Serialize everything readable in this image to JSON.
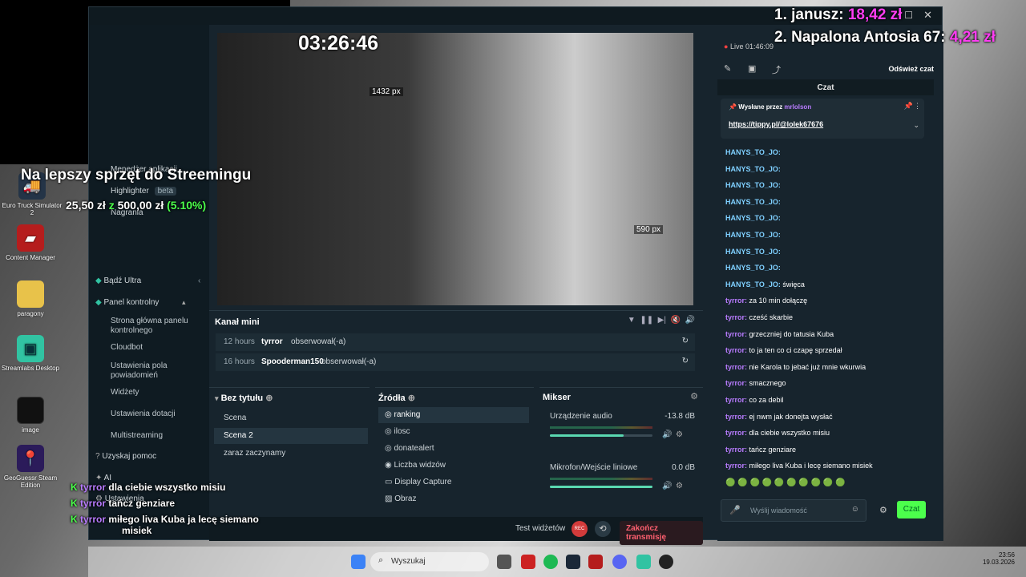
{
  "overlay": {
    "clock": "03:26:46",
    "top1": "1. janusz:",
    "top1_amount": "18,42 zł",
    "top2": "2. Napalona Antosia 67:",
    "top2_amount": "4,21 zł",
    "goal_title": "Na lepszy sprzęt do Streemingu",
    "goal_current": "25,50 zł",
    "goal_sep": "z",
    "goal_target": "500,00 zł",
    "goal_pct": "(5.10%)",
    "goal_pct_value": 5.1,
    "side_chat": [
      {
        "user": "tyrror",
        "text": "dla ciebie wszystko misiu"
      },
      {
        "user": "tyrror",
        "text": "tańcz genziare"
      },
      {
        "user": "tyrror",
        "text": "miłego liva Kuba ja lecę siemano"
      },
      {
        "user": "",
        "text": "misiek"
      }
    ]
  },
  "desktop": {
    "icons": [
      {
        "label": "Euro Truck Simulator 2",
        "icon": "truck-icon"
      },
      {
        "label": "Content Manager",
        "icon": "content-manager-icon"
      },
      {
        "label": "paragony",
        "icon": "folder-icon"
      },
      {
        "label": "Streamlabs Desktop",
        "icon": "streamlabs-icon"
      },
      {
        "label": "image",
        "icon": "image-icon"
      },
      {
        "label": "GeoGuessr Steam Edition",
        "icon": "geoguessr-icon"
      }
    ]
  },
  "sidebar": {
    "menedzer": "Menedżer aplikacji",
    "highlighter": "Highlighter",
    "beta": "beta",
    "nagrania": "Nagrania",
    "ultra": "Bądź Ultra",
    "panel": "Panel kontrolny",
    "sub": [
      "Strona główna panelu kontrolnego",
      "Cloudbot",
      "Ustawienia pola powiadomień",
      "Widżety",
      "Ustawienia dotacji",
      "Multistreaming"
    ],
    "help": "Uzyskaj pomoc",
    "ai": "AI",
    "settings": "Ustawienia"
  },
  "preview": {
    "width_label": "1432 px",
    "height_label": "590 px"
  },
  "mini_feed": {
    "title": "Kanał mini",
    "rows": [
      {
        "time": "12 hours",
        "user": "tyrror",
        "action": "obserwował(-a)"
      },
      {
        "time": "16 hours",
        "user": "Spooderman150",
        "action": "obserwował(-a)"
      }
    ]
  },
  "scenes": {
    "title": "Bez tytułu",
    "items": [
      "Scena",
      "Scena 2",
      "zaraz zaczynamy"
    ],
    "selected": "Scena 2"
  },
  "sources": {
    "title": "Źródła",
    "items": [
      "ranking",
      "ilosc",
      "donatealert",
      "Liczba widzów",
      "Display Capture",
      "Obraz"
    ],
    "selected": "ranking"
  },
  "mixer": {
    "title": "Mikser",
    "channels": [
      {
        "name": "Urządzenie audio",
        "db": "-13.8 dB",
        "level": 0.72
      },
      {
        "name": "Mikrofon/Wejście liniowe",
        "db": "0.0 dB",
        "level": 1.0
      }
    ]
  },
  "footer": {
    "test": "Test widżetów",
    "rec": "REC",
    "end": "Zakończ transmisję"
  },
  "chat": {
    "live": "Live 01:46:09",
    "refresh": "Odśwież czat",
    "title": "Czat",
    "pinned_by_label": "Wysłane przez",
    "pinned_by_user": "mrlolson",
    "pinned_link": "https://tippy.pl/@lolek67676",
    "messages": [
      {
        "user": "HANYS_TO_JO:",
        "text": "",
        "kind": "h"
      },
      {
        "user": "HANYS_TO_JO:",
        "text": "",
        "kind": "h"
      },
      {
        "user": "HANYS_TO_JO:",
        "text": "",
        "kind": "h"
      },
      {
        "user": "HANYS_TO_JO:",
        "text": "",
        "kind": "h"
      },
      {
        "user": "HANYS_TO_JO:",
        "text": "",
        "kind": "h"
      },
      {
        "user": "HANYS_TO_JO:",
        "text": "",
        "kind": "h"
      },
      {
        "user": "HANYS_TO_JO:",
        "text": "",
        "kind": "h"
      },
      {
        "user": "HANYS_TO_JO:",
        "text": "",
        "kind": "h"
      },
      {
        "user": "HANYS_TO_JO:",
        "text": "święca",
        "kind": "h"
      },
      {
        "user": "tyrror:",
        "text": "za 10 min dołączę",
        "kind": "u"
      },
      {
        "user": "tyrror:",
        "text": "cześć skarbie",
        "kind": "u"
      },
      {
        "user": "tyrror:",
        "text": "grzeczniej do tatusia Kuba",
        "kind": "u"
      },
      {
        "user": "tyrror:",
        "text": "to ja ten co ci czapę sprzedał",
        "kind": "u"
      },
      {
        "user": "tyrror:",
        "text": "nie Karola to jebać już mnie wkurwia",
        "kind": "u"
      },
      {
        "user": "tyrror:",
        "text": "smacznego",
        "kind": "u"
      },
      {
        "user": "tyrror:",
        "text": "co za debil",
        "kind": "u"
      },
      {
        "user": "tyrror:",
        "text": "ej nwm jak donejta wysłać",
        "kind": "u"
      },
      {
        "user": "tyrror:",
        "text": "dla ciebie wszystko misiu",
        "kind": "u"
      },
      {
        "user": "tyrror:",
        "text": "tańcz genziare",
        "kind": "u"
      },
      {
        "user": "tyrror:",
        "text": "miłego liva Kuba i lecę siemano misiek",
        "kind": "u"
      }
    ],
    "input_placeholder": "Wyślij wiadomość",
    "send": "Czat"
  },
  "taskbar": {
    "search_placeholder": "Wyszukaj",
    "time": "23:56",
    "date": "19.03.2026"
  },
  "colors": {
    "accent": "#31c3a2",
    "donation": "#ff3df3",
    "chat_user": "#b97cff",
    "send_button": "#4cff4c"
  }
}
